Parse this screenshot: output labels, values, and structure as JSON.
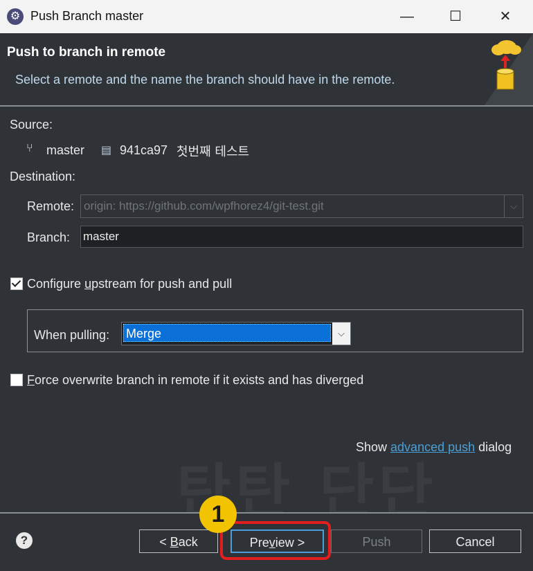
{
  "window": {
    "title": "Push Branch master",
    "minimize_icon": "minimize-icon",
    "maximize_icon": "maximize-icon",
    "close_icon": "close-icon"
  },
  "header": {
    "title": "Push to branch in remote",
    "description": "Select a remote and the name the branch should have in the remote."
  },
  "source": {
    "label": "Source:",
    "branch": "master",
    "commit_id": "941ca97",
    "commit_message": "첫번째 테스트"
  },
  "destination": {
    "label": "Destination:",
    "remote_label": "Remote:",
    "remote_value": "origin: https://github.com/wpfhorez4/git-test.git",
    "branch_label": "Branch:",
    "branch_value": "master"
  },
  "upstream": {
    "checkbox_label_before": "Configure ",
    "checkbox_label_mnemonic": "u",
    "checkbox_label_after": "pstream for push and pull",
    "checked": true,
    "when_pulling_label": "When pulling:",
    "when_pulling_value": "Merge"
  },
  "force": {
    "checkbox_label_mnemonic": "F",
    "checkbox_label_after": "orce overwrite branch in remote if it exists and has diverged",
    "checked": false
  },
  "advanced": {
    "prefix": "Show ",
    "link": "advanced push",
    "suffix": " dialog"
  },
  "watermark": "탄탄 단단",
  "footer": {
    "help": "?",
    "back_prefix": "< ",
    "back_mnemonic": "B",
    "back_suffix": "ack",
    "preview_prefix": "Pre",
    "preview_mnemonic": "v",
    "preview_suffix": "iew >",
    "push": "Push",
    "cancel": "Cancel"
  },
  "annotation": {
    "badge": "1"
  },
  "colors": {
    "background": "#2f3337",
    "accent": "#0a6fd6",
    "link": "#4a9fd8",
    "highlight_frame": "#e31e1e",
    "badge": "#f2c300"
  }
}
